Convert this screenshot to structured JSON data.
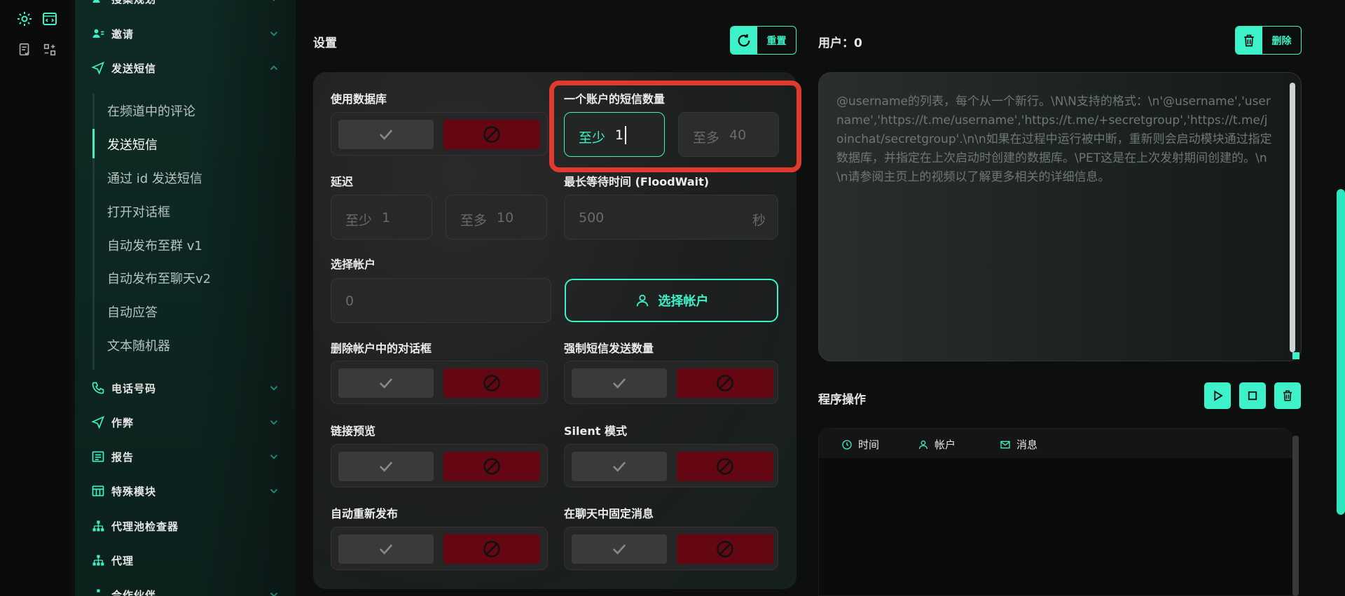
{
  "sidebar": {
    "sections": [
      {
        "label": "搜集规划",
        "icon": "users-icon"
      },
      {
        "label": "邀请",
        "icon": "user-add-icon"
      },
      {
        "label": "发送短信",
        "icon": "send-icon"
      },
      {
        "label": "电话号码",
        "icon": "phone-icon"
      },
      {
        "label": "作弊",
        "icon": "send-icon"
      },
      {
        "label": "报告",
        "icon": "report-icon"
      },
      {
        "label": "特殊模块",
        "icon": "grid-icon"
      },
      {
        "label": "代理池检查器",
        "icon": "network-icon"
      },
      {
        "label": "代理",
        "icon": "network-icon"
      },
      {
        "label": "合作伙伴",
        "icon": "network-icon"
      }
    ],
    "sub_items": [
      "在频道中的评论",
      "发送短信",
      "通过 id 发送短信",
      "打开对话框",
      "自动发布至群 v1",
      "自动发布至聊天v2",
      "自动应答",
      "文本随机器"
    ]
  },
  "settings": {
    "title": "设置",
    "reset_label": "重置",
    "use_db_label": "使用数据库",
    "sms_per_account_label": "一个账户的短信数量",
    "sms_min_prefix": "至少",
    "sms_min_value": "1",
    "sms_max_prefix": "至多",
    "sms_max_value": "40",
    "delay_label": "延迟",
    "delay_min_prefix": "至少",
    "delay_min_value": "1",
    "delay_max_prefix": "至多",
    "delay_max_value": "10",
    "floodwait_label": "最长等待时间 (FloodWait)",
    "floodwait_value": "500",
    "floodwait_unit": "秒",
    "choose_account_label": "选择帐户",
    "account_count": "0",
    "choose_account_btn": "选择帐户",
    "delete_dialogs_label": "删除帐户中的对话框",
    "force_count_label": "强制短信发送数量",
    "link_preview_label": "链接预览",
    "silent_label": "Silent 模式",
    "auto_repost_label": "自动重新发布",
    "pin_label": "在聊天中固定消息"
  },
  "users": {
    "title": "用户：0",
    "delete_label": "删除",
    "placeholder": "@username的列表，每个从一个新行。\\N\\N支持的格式：\\n'@username','username','https://t.me/username','https://t.me/+secretgroup','https://t.me/joinchat/secretgroup'.\\n\\n如果在过程中运行被中断，重新则会启动模块通过指定数据库，并指定在上次启动时创建的数据库。\\PET这是在上次发射期间创建的。\\n\\n请参阅主页上的视频以了解更多相关的详细信息。"
  },
  "operations": {
    "title": "程序操作",
    "columns": [
      "时间",
      "帐户",
      "消息"
    ]
  },
  "colors": {
    "accent": "#3df2c8",
    "danger": "#650713",
    "highlight": "#e03a2e"
  }
}
